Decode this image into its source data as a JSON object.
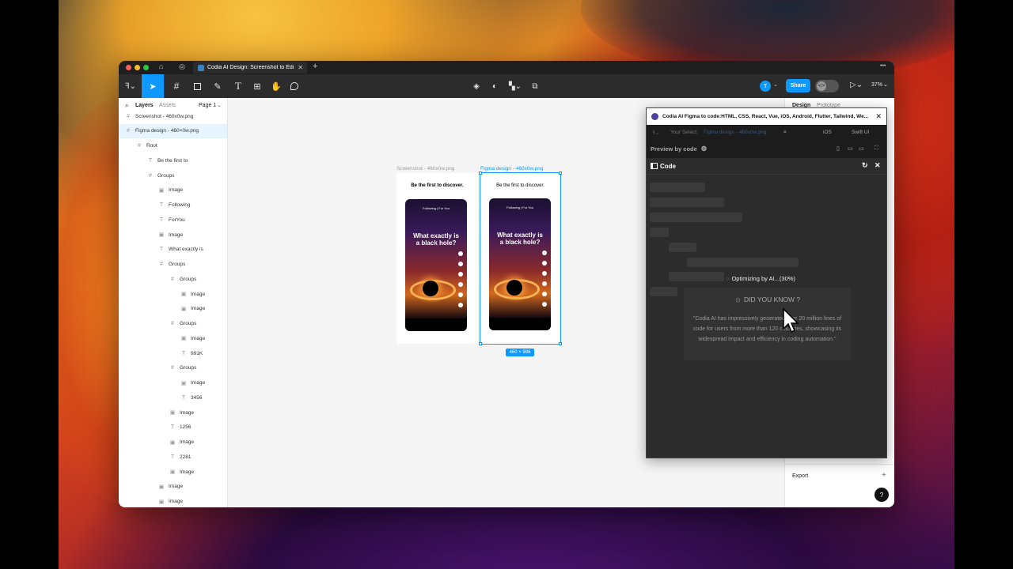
{
  "window": {
    "tab_title": "Codia AI Design: Screenshot to Edi",
    "new_tab": "+",
    "more": "•••"
  },
  "toolbar": {
    "share_label": "Share",
    "avatar_initial": "T",
    "zoom": "37%"
  },
  "left_panel": {
    "tabs": [
      "Layers",
      "Assets"
    ],
    "page_selector": "Page 1",
    "layers": [
      {
        "label": "Screenshot - 460x0w.png",
        "depth": 0,
        "type": "frame"
      },
      {
        "label": "Figma design - 460×0w.png",
        "depth": 0,
        "type": "frame",
        "selected": true
      },
      {
        "label": "Root",
        "depth": 1,
        "type": "frame"
      },
      {
        "label": "Be the first to",
        "depth": 2,
        "type": "text"
      },
      {
        "label": "Groups",
        "depth": 2,
        "type": "frame"
      },
      {
        "label": "Image",
        "depth": 3,
        "type": "image"
      },
      {
        "label": "Following",
        "depth": 3,
        "type": "text"
      },
      {
        "label": "ForYou",
        "depth": 3,
        "type": "text"
      },
      {
        "label": "Image",
        "depth": 3,
        "type": "image"
      },
      {
        "label": "What exactly is",
        "depth": 3,
        "type": "text"
      },
      {
        "label": "Groups",
        "depth": 3,
        "type": "frame"
      },
      {
        "label": "Groups",
        "depth": 4,
        "type": "frame"
      },
      {
        "label": "Image",
        "depth": 5,
        "type": "image"
      },
      {
        "label": "Image",
        "depth": 5,
        "type": "image"
      },
      {
        "label": "Groups",
        "depth": 4,
        "type": "frame"
      },
      {
        "label": "Image",
        "depth": 5,
        "type": "image"
      },
      {
        "label": "991K",
        "depth": 5,
        "type": "text"
      },
      {
        "label": "Groups",
        "depth": 4,
        "type": "frame"
      },
      {
        "label": "Image",
        "depth": 5,
        "type": "image"
      },
      {
        "label": "3456",
        "depth": 5,
        "type": "text"
      },
      {
        "label": "Image",
        "depth": 4,
        "type": "image"
      },
      {
        "label": "1256",
        "depth": 4,
        "type": "text"
      },
      {
        "label": "Image",
        "depth": 4,
        "type": "image"
      },
      {
        "label": "2281",
        "depth": 4,
        "type": "text"
      },
      {
        "label": "Image",
        "depth": 4,
        "type": "image"
      },
      {
        "label": "Image",
        "depth": 3,
        "type": "image"
      },
      {
        "label": "Image",
        "depth": 3,
        "type": "image"
      }
    ]
  },
  "canvas": {
    "frame1_label": "Screenshot - 460x0w.png",
    "frame2_label": "Figma design - 460x0w.png",
    "size_badge": "460 × 996",
    "frame1_heading": "Be the first to discover.",
    "frame2_heading": "Be the first to discover.",
    "phone_heading": "What exactly is a black hole?",
    "phone_top": "Following  |  For You"
  },
  "right_panel": {
    "tabs": [
      "Design",
      "Prototype"
    ],
    "export_label": "Export",
    "export_add": "+",
    "help": "?"
  },
  "plugin": {
    "title": "Codia AI Figma to code:HTML, CSS, React, Vue, iOS, Android, Flutter, Tailwind, We...",
    "selection_label": "Your Select:",
    "selection_value": "Figma design - 460x0w.png",
    "platform": "iOS",
    "framework": "Swift UI",
    "preview_label": "Preview by code",
    "code_label": "Code",
    "status": "Optimizing by AI...(30%)",
    "dyk_title": "DID YOU KNOW ?",
    "dyk_body": "\"Codia AI has impressively generated over 20 million lines of code for users from more than 120 countries, showcasing its widespread impact and efficiency in coding automation.\""
  }
}
